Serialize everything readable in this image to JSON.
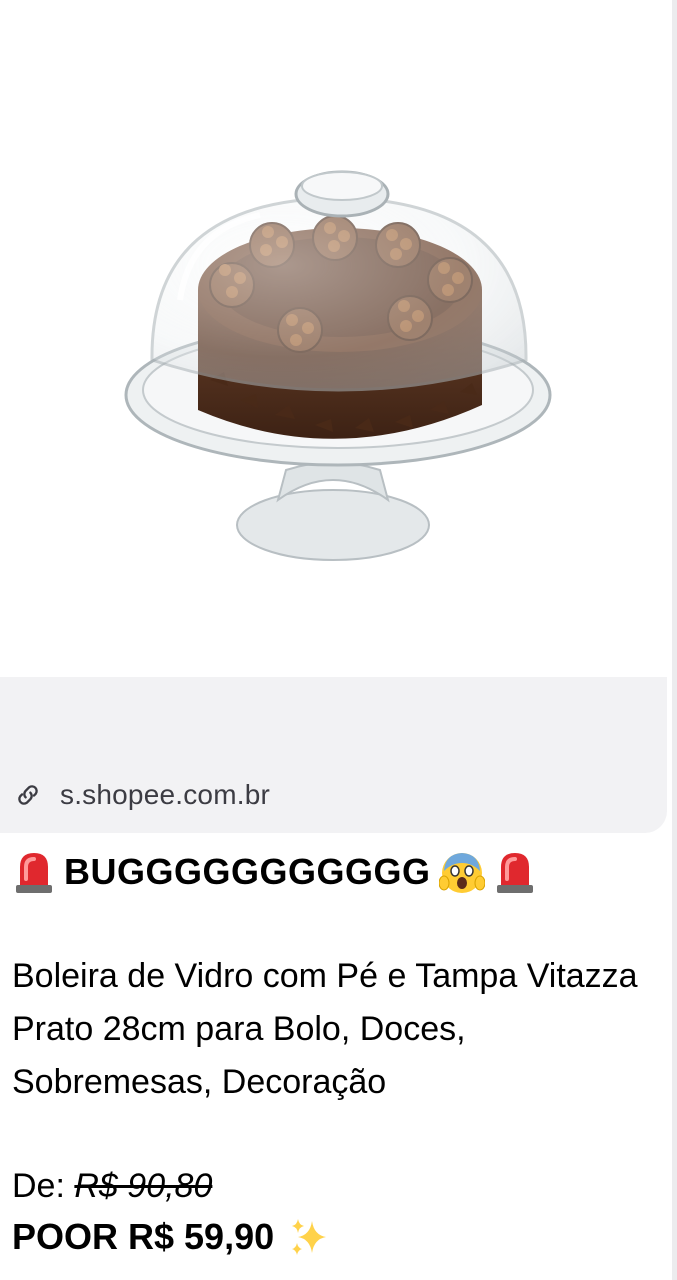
{
  "preview": {
    "image_alt": "Boleira de vidro com bolo de chocolate",
    "domain": "s.shopee.com.br",
    "link_icon": "link-icon"
  },
  "message": {
    "headline": "BUGGGGGGGGGGG",
    "headline_icons": [
      "siren-icon",
      "scream-face-icon",
      "siren-icon"
    ],
    "description": "Boleira de Vidro com Pé e Tampa Vitazza Prato 28cm para Bolo, Doces, Sobremesas, Decoração",
    "price_old_label": "De:",
    "price_old_value": "R$ 90,80",
    "price_new": "POOR R$ 59,90",
    "price_icon": "sparkles-icon"
  },
  "colors": {
    "card_footer": "#f2f2f4",
    "domain_text": "#3c3c43",
    "chocolate": "#5a3420"
  }
}
